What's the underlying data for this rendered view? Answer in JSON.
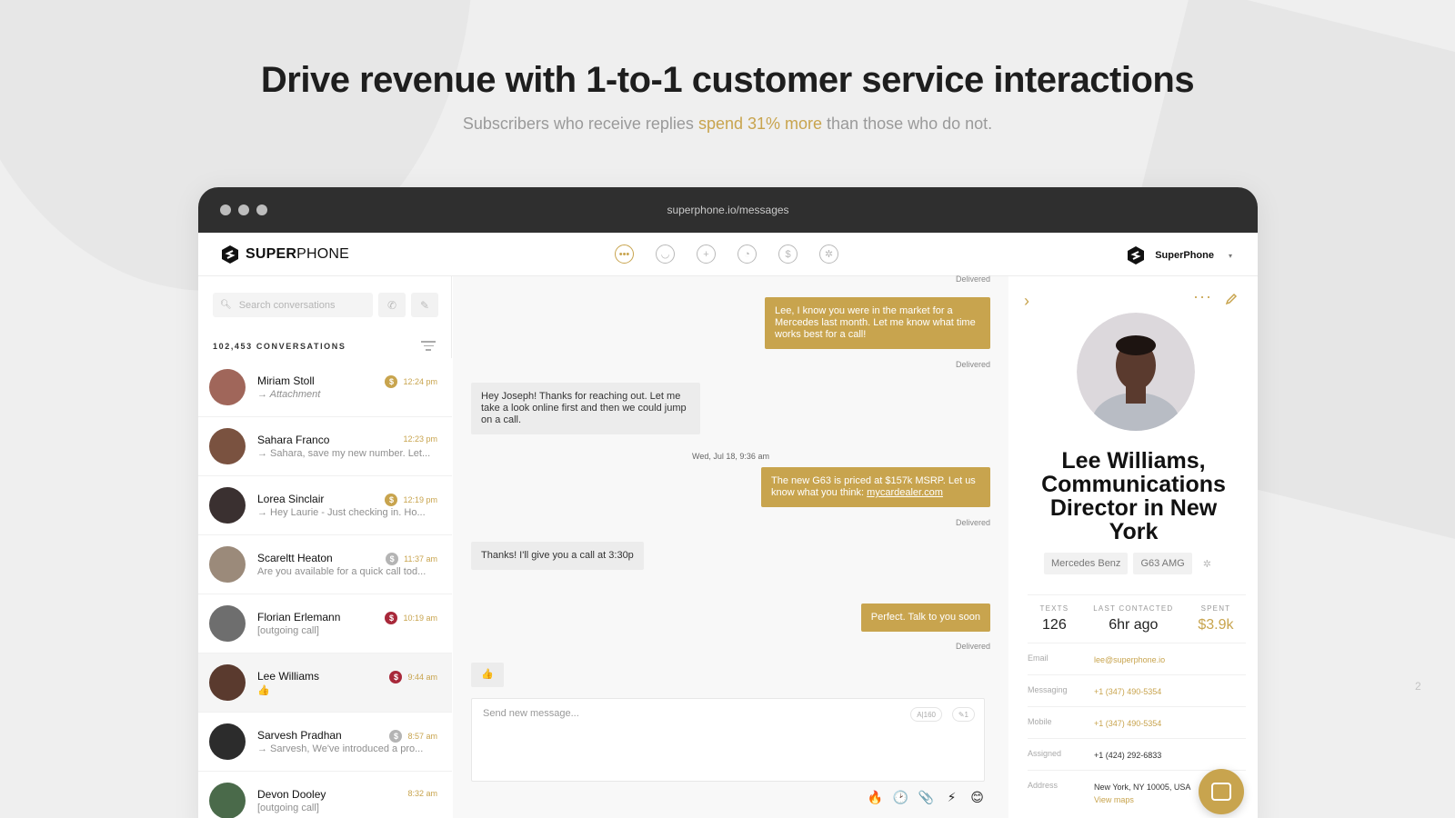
{
  "hero": {
    "title": "Drive revenue with 1-to-1 customer service interactions",
    "sub_before": "Subscribers who receive replies ",
    "sub_highlight": "spend 31% more",
    "sub_after": " than those who do not."
  },
  "page_number": "2",
  "window": {
    "url": "superphone.io/messages"
  },
  "app": {
    "logo_bold": "SUPER",
    "logo_light": "PHONE",
    "nav_icons": [
      "messages-icon",
      "contacts-icon",
      "add-icon",
      "analytics-icon",
      "payments-icon",
      "settings-icon"
    ],
    "account_name": "SuperPhone",
    "account_caret": "▾"
  },
  "sidebar": {
    "search_placeholder": "Search conversations",
    "conversation_count": "102,453 CONVERSATIONS",
    "conversations": [
      {
        "name": "Miriam Stoll",
        "preview": "→ Attachment",
        "time": "12:24 pm",
        "coin": "$",
        "coin_color": "#c8a44e",
        "italic": true,
        "avatar_color": "#a0665a"
      },
      {
        "name": "Sahara Franco",
        "preview": "→ Sahara, save my new number. Let...",
        "time": "12:23 pm",
        "coin": "",
        "coin_color": "",
        "italic": false,
        "avatar_color": "#7a5240"
      },
      {
        "name": "Lorea Sinclair",
        "preview": "→ Hey Laurie - Just checking in. Ho...",
        "time": "12:19 pm",
        "coin": "$",
        "coin_color": "#c8a44e",
        "italic": false,
        "avatar_color": "#3a3030"
      },
      {
        "name": "Scareltt Heaton",
        "preview": "Are you available for a quick call tod...",
        "time": "11:37 am",
        "coin": "$",
        "coin_color": "#b4b4b4",
        "italic": false,
        "avatar_color": "#9b8a7a"
      },
      {
        "name": "Florian Erlemann",
        "preview": "[outgoing call]",
        "time": "10:19 am",
        "coin": "$",
        "coin_color": "#a8283a",
        "italic": false,
        "avatar_color": "#6e6e6e"
      },
      {
        "name": "Lee Williams",
        "preview": "👍",
        "time": "9:44 am",
        "coin": "$",
        "coin_color": "#a8283a",
        "italic": false,
        "avatar_color": "#5a3a2e",
        "selected": true
      },
      {
        "name": "Sarvesh Pradhan",
        "preview": "→ Sarvesh, We've introduced a pro...",
        "time": "8:57 am",
        "coin": "$",
        "coin_color": "#b4b4b4",
        "italic": false,
        "avatar_color": "#2c2c2c"
      },
      {
        "name": "Devon Dooley",
        "preview": "[outgoing call]",
        "time": "8:32 am",
        "coin": "",
        "coin_color": "",
        "italic": false,
        "avatar_color": "#4a6a4a"
      }
    ]
  },
  "chat": {
    "top_status": "Delivered",
    "msg1": "Lee, I know you were in the market for a Mercedes last month. Let me know what time works best for a call!",
    "msg1_status": "Delivered",
    "msg2": "Hey Joseph! Thanks for reaching out. Let me take a look online first and then we could jump on a call.",
    "date": "Wed, Jul 18,",
    "time": "9:36 am",
    "msg3_text": "The new G63 is priced at $157k MSRP. Let us know what you think: ",
    "msg3_link": "mycardealer.com",
    "msg3_status": "Delivered",
    "msg4": "Thanks! I'll give you a call at 3:30p",
    "msg5": "Perfect. Talk to you soon",
    "msg5_status": "Delivered",
    "msg6": "👍",
    "composer_placeholder": "Send new message...",
    "char_count": "A|160",
    "segment_count": "✎1",
    "tools": [
      "🔥",
      "🕑",
      "📎",
      "⚡",
      "😊"
    ]
  },
  "profile": {
    "name": "Lee Williams, Communications Director in New York",
    "tags": [
      "Mercedes Benz",
      "G63 AMG"
    ],
    "stats": [
      {
        "label": "TEXTS",
        "value": "126"
      },
      {
        "label": "LAST CONTACTED",
        "value": "6hr ago"
      },
      {
        "label": "SPENT",
        "value": "$3.9k"
      }
    ],
    "fields": [
      {
        "label": "Email",
        "value": "lee@superphone.io"
      },
      {
        "label": "Messaging",
        "value": "+1 (347) 490-5354"
      },
      {
        "label": "Mobile",
        "value": "+1 (347) 490-5354"
      },
      {
        "label": "Assigned",
        "value": "+1 (424) 292-6833"
      },
      {
        "label": "Address",
        "value": "New York, NY 10005, USA",
        "link": "View maps"
      }
    ]
  },
  "colors": {
    "accent": "#c8a44e",
    "danger": "#a8283a",
    "dark": "#2f2f2f"
  }
}
